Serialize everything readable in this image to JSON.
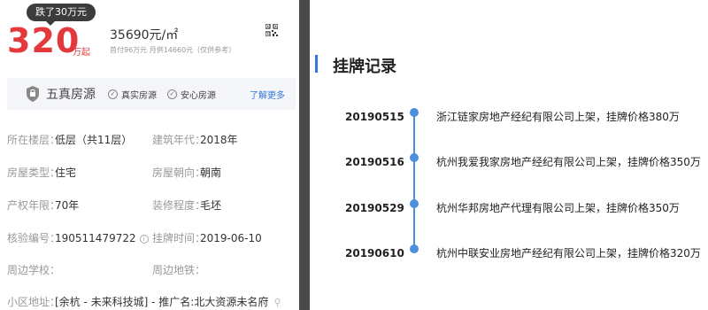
{
  "price": {
    "badge": "跌了30万元",
    "amount": "320",
    "unit": "万起",
    "unit_price": "35690元/㎡",
    "down_payment": "首付96万元 月供14660元（仅供参考）"
  },
  "five_real": {
    "title": "五真房源",
    "items": [
      "真实房源",
      "安心房源"
    ],
    "more": "了解更多"
  },
  "info": {
    "floor_label": "所在楼层：",
    "floor_value": "低层（共11层）",
    "year_label": "建筑年代：",
    "year_value": "2018年",
    "type_label": "房屋类型：",
    "type_value": "住宅",
    "orient_label": "房屋朝向：",
    "orient_value": "朝南",
    "term_label": "产权年限：",
    "term_value": "70年",
    "deco_label": "装修程度：",
    "deco_value": "毛坯",
    "code_label": "核验编号：",
    "code_value": "190511479722",
    "time_label": "挂牌时间：",
    "time_value": "2019-06-10",
    "school_label": "周边学校：",
    "metro_label": "周边地铁：",
    "community_label": "小区地址：",
    "community_value": "[余杭 - 未来科技城] - 推广名:北大资源未名府"
  },
  "history": {
    "title": "挂牌记录",
    "records": [
      {
        "date": "20190515",
        "text": "浙江链家房地产经纪有限公司上架，挂牌价格380万"
      },
      {
        "date": "20190516",
        "text": "杭州我爱我家房地产经纪有限公司上架，挂牌价格350万"
      },
      {
        "date": "20190529",
        "text": "杭州华邦房地产代理有限公司上架，挂牌价格350万"
      },
      {
        "date": "20190610",
        "text": "杭州中联安业房地产经纪有限公司上架，挂牌价格320万"
      }
    ]
  },
  "colors": {
    "price": "#e4393c",
    "accent": "#3377dd",
    "timeline": "#4a8fe0",
    "divider": "#4a4a4a"
  },
  "icons": [
    "qr-code-icon",
    "shield-icon",
    "check-icon",
    "info-icon",
    "location-pin-icon"
  ]
}
